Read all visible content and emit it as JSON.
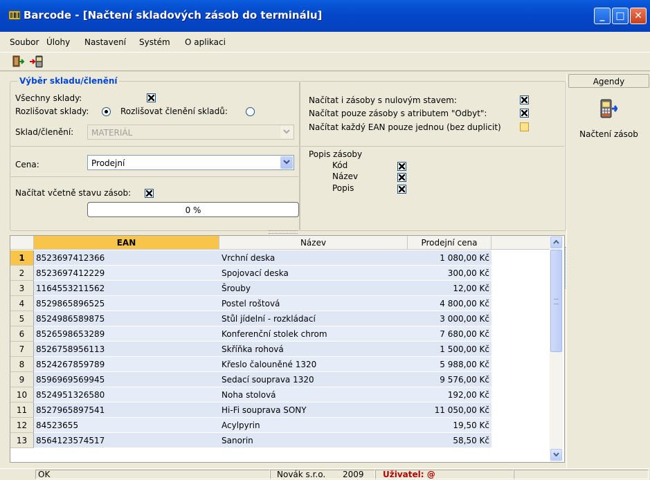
{
  "window": {
    "title": "Barcode - [Načtení skladových zásob do terminálu]"
  },
  "menu": [
    "Soubor",
    "Úlohy",
    "Nastavení",
    "Systém",
    "O aplikaci"
  ],
  "toolbar": {
    "buttons": [
      "exit-icon",
      "load-terminal-icon"
    ]
  },
  "form": {
    "group_title": "Výběr skladu/členění",
    "all_warehouses_label": "Všechny sklady:",
    "all_warehouses_checked": true,
    "distinguish_warehouses_label": "Rozlišovat sklady:",
    "distinguish_sections_label": "Rozlišovat členění skladů:",
    "radio_selected": "warehouses",
    "warehouse_label": "Sklad/členění:",
    "warehouse_value": "MATERIÁL",
    "price_label": "Cena:",
    "price_value": "Prodejní",
    "load_with_stock_label": "Načítat včetně stavu zásob:",
    "load_with_stock_checked": true,
    "progress_text": "0 %",
    "progress_value": 0,
    "zero_stock_label": "Načítat i zásoby s nulovým stavem:",
    "zero_stock_checked": true,
    "odbyt_label": "Načítat pouze zásoby s atributem \"Odbyt\":",
    "odbyt_checked": true,
    "ean_once_label": "Načítat každý EAN pouze jednou (bez duplicit)",
    "ean_once_checked": false,
    "description_title": "Popis zásoby",
    "description_items": [
      {
        "label": "Kód",
        "checked": true
      },
      {
        "label": "Název",
        "checked": true
      },
      {
        "label": "Popis",
        "checked": true
      }
    ]
  },
  "agendy": {
    "header": "Agendy",
    "item_label": "Načtení zásob",
    "item_icon": "terminal-load-icon"
  },
  "table": {
    "columns": [
      "EAN",
      "Název",
      "Prodejní cena"
    ],
    "rows": [
      {
        "n": "1",
        "ean": "8523697412366",
        "name": "Vrchní deska",
        "price": "1 080,00 Kč"
      },
      {
        "n": "2",
        "ean": "8523697412229",
        "name": "Spojovací deska",
        "price": "300,00 Kč"
      },
      {
        "n": "3",
        "ean": "1164553211562",
        "name": "Šrouby",
        "price": "12,00 Kč"
      },
      {
        "n": "4",
        "ean": "8529865896525",
        "name": "Postel roštová",
        "price": "4 800,00 Kč"
      },
      {
        "n": "5",
        "ean": "8524986589875",
        "name": "Stůl jídelní - rozkládací",
        "price": "3 000,00 Kč"
      },
      {
        "n": "6",
        "ean": "8526598653289",
        "name": "Konferenční stolek chrom",
        "price": "7 680,00 Kč"
      },
      {
        "n": "7",
        "ean": "8526758956113",
        "name": "Skříňka rohová",
        "price": "1 500,00 Kč"
      },
      {
        "n": "8",
        "ean": "8524267859789",
        "name": "Křeslo čalouněné 1320",
        "price": "5 988,00 Kč"
      },
      {
        "n": "9",
        "ean": "8596969569945",
        "name": "Sedací souprava 1320",
        "price": "9 576,00 Kč"
      },
      {
        "n": "10",
        "ean": "8524951326580",
        "name": "Noha stolová",
        "price": "192,00 Kč"
      },
      {
        "n": "11",
        "ean": "8527965897541",
        "name": "Hi-Fi souprava SONY",
        "price": "11 050,00 Kč"
      },
      {
        "n": "12",
        "ean": "84523655",
        "name": "Acylpyrin",
        "price": "19,50 Kč"
      },
      {
        "n": "13",
        "ean": "8564123574517",
        "name": "Sanorin",
        "price": "58,50 Kč"
      }
    ]
  },
  "status": {
    "state": "OK",
    "company": "Novák s.r.o.",
    "year": "2009",
    "user_label": "Uživatel: @"
  },
  "colors": {
    "titlebar": "#0542be",
    "accent_header": "#f9c44a",
    "legend": "#0046d5",
    "user_label": "#b40000"
  }
}
